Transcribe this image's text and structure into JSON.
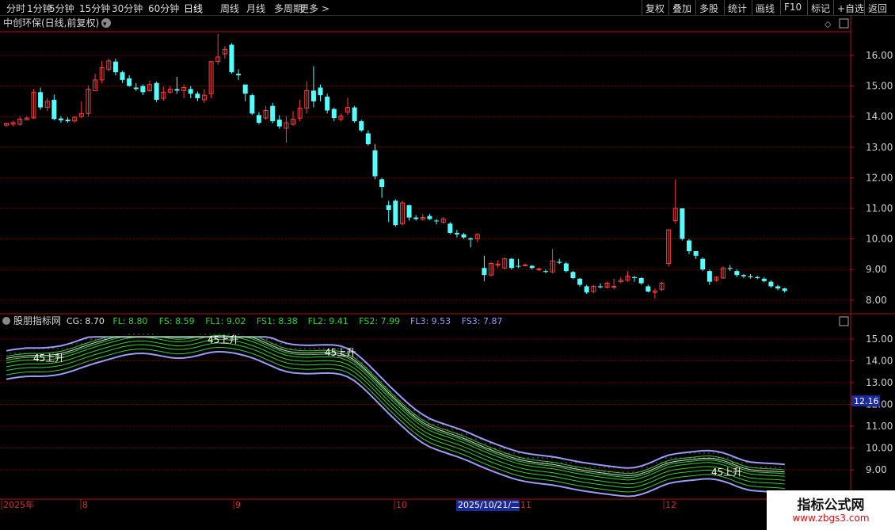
{
  "toolbar": {
    "left_items": [
      "分时",
      "1分钟",
      "5分钟",
      "15分钟",
      "30分钟",
      "60分钟",
      "日线",
      "周线",
      "月线",
      "多周期",
      "更多 >"
    ],
    "active": "日线",
    "right_items": [
      "复权",
      "叠加",
      "多股",
      "统计",
      "画线",
      "F10",
      "标记",
      "+自选",
      "返回"
    ]
  },
  "main_chart": {
    "title": "中创环保(日线,前复权)",
    "y_ticks": [
      "16.00",
      "15.00",
      "14.00",
      "13.00",
      "12.00",
      "11.00",
      "10.00",
      "9.00",
      "8.00"
    ]
  },
  "indicator": {
    "name": "股朋指标网",
    "values": [
      {
        "label": "CG: 8.70",
        "color": "#e0e0e0"
      },
      {
        "label": "FL: 8.80",
        "color": "#32d232"
      },
      {
        "label": "FS: 8.59",
        "color": "#32d232"
      },
      {
        "label": "FL1: 9.02",
        "color": "#32d232"
      },
      {
        "label": "FS1: 8.38",
        "color": "#32d232"
      },
      {
        "label": "FL2: 9.41",
        "color": "#32d232"
      },
      {
        "label": "FS2: 7.99",
        "color": "#32d232"
      },
      {
        "label": "FL3: 9.53",
        "color": "#9a9cf5"
      },
      {
        "label": "FS3: 7.87",
        "color": "#9a9cf5"
      }
    ],
    "y_ticks": [
      "15.00",
      "14.00",
      "13.00",
      "12.00",
      "11.00",
      "10.00",
      "9.00"
    ],
    "current_value": "12.16",
    "signal_label": "45上升"
  },
  "x_axis": {
    "labels": [
      "2025年",
      "8",
      "9",
      "10",
      "11",
      "12"
    ],
    "highlight": "2025/10/21/二"
  },
  "watermark": {
    "line1": "指标公式网",
    "line2": "www.zbgs3.com"
  },
  "colors": {
    "up": "#ff3c3c",
    "down": "#54ffff",
    "grid": "#8b0000",
    "axis": "#b01414",
    "envelope": "#9a9cf5",
    "green": "#32d232",
    "white": "#e0e0e0"
  },
  "candles": [
    [
      13.72,
      13.78,
      13.66,
      13.8
    ],
    [
      13.75,
      13.8,
      13.68,
      13.86
    ],
    [
      13.75,
      13.92,
      13.7,
      14.02
    ],
    [
      13.9,
      13.95,
      13.88,
      14.02
    ],
    [
      13.96,
      14.8,
      13.92,
      14.9
    ],
    [
      14.8,
      14.3,
      14.22,
      14.95
    ],
    [
      14.3,
      14.5,
      14.18,
      14.6
    ],
    [
      14.55,
      13.92,
      13.88,
      14.72
    ],
    [
      13.94,
      13.88,
      13.8,
      14.02
    ],
    [
      13.9,
      13.85,
      13.8,
      13.98
    ],
    [
      13.86,
      13.98,
      13.8,
      14.02
    ],
    [
      14.0,
      14.1,
      13.95,
      14.5
    ],
    [
      14.1,
      14.9,
      14.0,
      15.02
    ],
    [
      14.85,
      15.2,
      14.9,
      15.4
    ],
    [
      15.2,
      15.6,
      15.08,
      15.82
    ],
    [
      15.55,
      15.82,
      15.48,
      15.9
    ],
    [
      15.8,
      15.45,
      15.35,
      15.9
    ],
    [
      15.45,
      15.2,
      15.1,
      15.5
    ],
    [
      15.25,
      15.0,
      14.98,
      15.35
    ],
    [
      14.95,
      14.9,
      14.84,
      15.1
    ],
    [
      15.0,
      14.8,
      14.7,
      15.05
    ],
    [
      14.85,
      15.05,
      14.8,
      15.18
    ],
    [
      15.1,
      14.55,
      14.48,
      15.15
    ],
    [
      14.6,
      14.8,
      14.52,
      14.98
    ],
    [
      14.8,
      14.9,
      14.75,
      15.0
    ],
    [
      14.9,
      14.85,
      14.75,
      15.3
    ],
    [
      14.85,
      14.95,
      14.6,
      15.05
    ],
    [
      14.9,
      14.75,
      14.6,
      15.0
    ],
    [
      14.75,
      14.6,
      14.5,
      14.82
    ],
    [
      14.55,
      14.7,
      14.45,
      14.9
    ],
    [
      14.75,
      15.8,
      14.6,
      15.8
    ],
    [
      15.8,
      15.95,
      15.7,
      16.7
    ],
    [
      16.05,
      16.2,
      15.9,
      16.3
    ],
    [
      16.35,
      15.45,
      15.4,
      16.4
    ],
    [
      15.4,
      15.35,
      15.2,
      15.55
    ],
    [
      15.05,
      14.75,
      14.5,
      15.05
    ],
    [
      14.7,
      14.1,
      14.05,
      14.75
    ],
    [
      14.05,
      13.8,
      13.75,
      14.15
    ],
    [
      13.95,
      14.2,
      13.9,
      14.35
    ],
    [
      14.35,
      13.85,
      13.78,
      14.45
    ],
    [
      13.9,
      13.68,
      13.6,
      14.05
    ],
    [
      13.62,
      13.8,
      13.15,
      14.02
    ],
    [
      13.75,
      13.92,
      13.7,
      14.18
    ],
    [
      13.95,
      14.28,
      13.85,
      14.55
    ],
    [
      14.28,
      14.85,
      14.1,
      15.15
    ],
    [
      14.85,
      14.5,
      14.3,
      15.65
    ],
    [
      14.95,
      14.7,
      14.5,
      15.05
    ],
    [
      14.65,
      14.2,
      14.1,
      14.75
    ],
    [
      14.25,
      13.95,
      13.85,
      14.3
    ],
    [
      13.92,
      14.02,
      13.85,
      14.1
    ],
    [
      14.15,
      14.3,
      14.05,
      14.62
    ],
    [
      14.3,
      13.85,
      13.8,
      14.35
    ],
    [
      13.85,
      13.55,
      13.5,
      13.9
    ],
    [
      13.45,
      13.1,
      13.05,
      13.55
    ],
    [
      12.9,
      12.05,
      11.95,
      13.1
    ],
    [
      11.95,
      11.7,
      11.35,
      12.0
    ],
    [
      11.1,
      10.95,
      10.55,
      11.25
    ],
    [
      11.25,
      10.45,
      10.4,
      11.3
    ],
    [
      10.5,
      11.18,
      10.45,
      11.25
    ],
    [
      11.1,
      10.7,
      10.6,
      11.12
    ],
    [
      10.7,
      10.65,
      10.6,
      10.78
    ],
    [
      10.65,
      10.7,
      10.6,
      10.82
    ],
    [
      10.75,
      10.65,
      10.62,
      10.82
    ],
    [
      10.6,
      10.58,
      10.48,
      10.65
    ],
    [
      10.55,
      10.65,
      10.5,
      10.72
    ],
    [
      10.5,
      10.2,
      10.15,
      10.55
    ],
    [
      10.2,
      10.15,
      10.05,
      10.3
    ],
    [
      10.15,
      10.05,
      10.0,
      10.2
    ],
    [
      10.02,
      9.98,
      9.72,
      10.05
    ],
    [
      10.0,
      10.15,
      9.9,
      10.18
    ],
    [
      9.05,
      8.82,
      8.62,
      9.45
    ],
    [
      8.82,
      9.2,
      8.78,
      9.25
    ],
    [
      9.15,
      9.18,
      9.05,
      9.3
    ],
    [
      9.05,
      9.35,
      9.0,
      9.4
    ],
    [
      9.35,
      9.05,
      9.0,
      9.38
    ],
    [
      9.12,
      9.1,
      9.05,
      9.35
    ],
    [
      9.12,
      9.15,
      9.1,
      9.2
    ],
    [
      9.12,
      9.05,
      9.0,
      9.15
    ],
    [
      9.0,
      9.02,
      8.95,
      9.06
    ],
    [
      8.95,
      8.92,
      8.88,
      9.0
    ],
    [
      8.92,
      9.28,
      8.88,
      9.68
    ],
    [
      9.25,
      9.22,
      9.18,
      9.35
    ],
    [
      9.2,
      8.95,
      8.9,
      9.25
    ],
    [
      8.92,
      8.72,
      8.68,
      8.95
    ],
    [
      8.7,
      8.5,
      8.44,
      8.72
    ],
    [
      8.45,
      8.25,
      8.2,
      8.5
    ],
    [
      8.28,
      8.45,
      8.22,
      8.5
    ],
    [
      8.45,
      8.42,
      8.38,
      8.55
    ],
    [
      8.42,
      8.55,
      8.38,
      8.6
    ],
    [
      8.45,
      8.45,
      8.35,
      8.7
    ],
    [
      8.6,
      8.65,
      8.55,
      8.75
    ],
    [
      8.65,
      8.78,
      8.6,
      8.95
    ],
    [
      8.75,
      8.72,
      8.6,
      8.8
    ],
    [
      8.72,
      8.55,
      8.5,
      8.75
    ],
    [
      8.45,
      8.28,
      8.25,
      8.5
    ],
    [
      8.25,
      8.3,
      8.05,
      8.38
    ],
    [
      8.35,
      8.55,
      8.3,
      8.6
    ],
    [
      9.2,
      10.3,
      9.1,
      10.3
    ],
    [
      10.6,
      11.0,
      10.5,
      11.95
    ],
    [
      11.0,
      10.0,
      9.95,
      11.0
    ],
    [
      9.95,
      9.6,
      9.5,
      10.0
    ],
    [
      9.6,
      9.45,
      9.35,
      9.6
    ],
    [
      9.35,
      9.0,
      8.95,
      9.4
    ],
    [
      8.95,
      8.6,
      8.5,
      9.0
    ],
    [
      8.65,
      8.75,
      8.6,
      8.78
    ],
    [
      8.72,
      9.05,
      8.7,
      9.1
    ],
    [
      9.05,
      9.02,
      8.95,
      9.15
    ],
    [
      8.95,
      8.82,
      8.75,
      9.0
    ],
    [
      8.82,
      8.78,
      8.72,
      8.85
    ],
    [
      8.78,
      8.75,
      8.7,
      8.85
    ],
    [
      8.75,
      8.72,
      8.68,
      8.8
    ],
    [
      8.7,
      8.62,
      8.58,
      8.75
    ],
    [
      8.6,
      8.45,
      8.4,
      8.65
    ],
    [
      8.45,
      8.38,
      8.32,
      8.5
    ],
    [
      8.38,
      8.3,
      8.25,
      8.4
    ]
  ]
}
